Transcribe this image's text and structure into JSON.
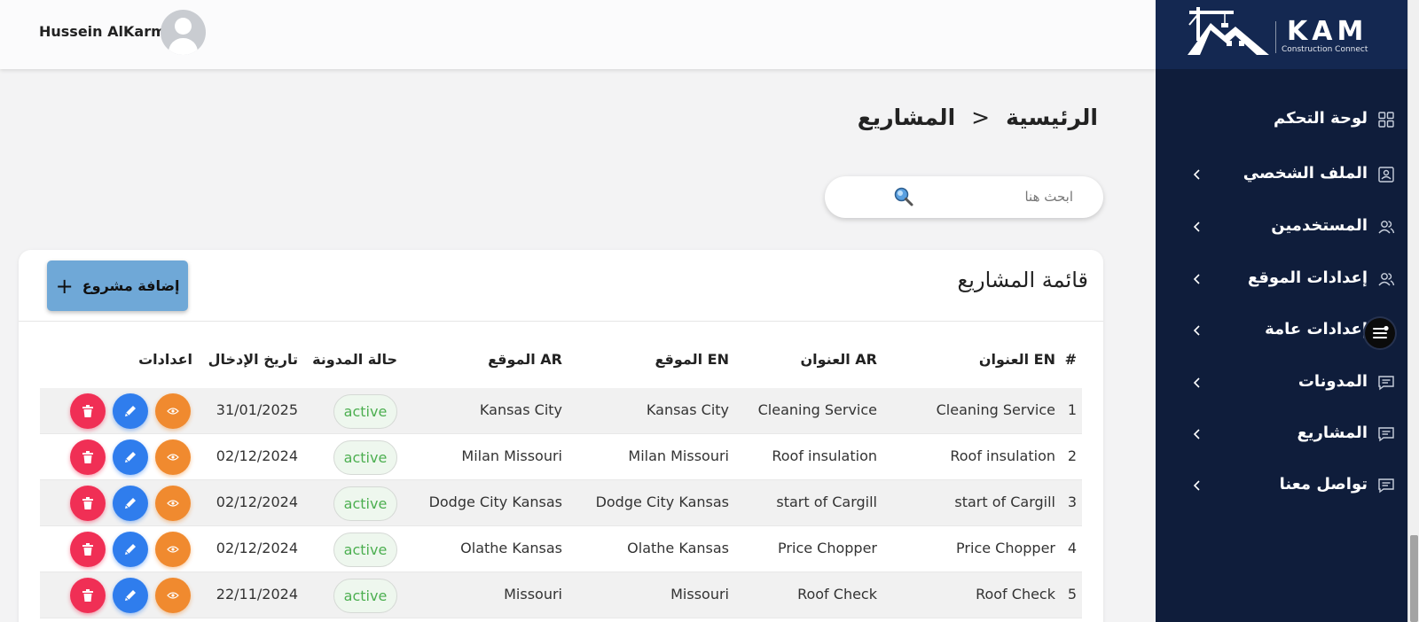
{
  "header": {
    "user_name": "Hussein AlKarmi"
  },
  "logo": {
    "name": "KAM",
    "tagline": "Construction Connect"
  },
  "sidebar": {
    "items": [
      {
        "label": "لوحة التحكم",
        "icon": "grid-icon",
        "has_chevron": false
      },
      {
        "label": "الملف الشخصي",
        "icon": "profile-card-icon",
        "has_chevron": true
      },
      {
        "label": "المستخدمين",
        "icon": "users-icon",
        "has_chevron": true
      },
      {
        "label": "إعدادات الموقع",
        "icon": "users-icon",
        "has_chevron": true
      },
      {
        "label": "إعدادات عامة",
        "icon": "settings-icon",
        "has_chevron": true
      },
      {
        "label": "المدونات",
        "icon": "message-icon",
        "has_chevron": true
      },
      {
        "label": "المشاريع",
        "icon": "message-icon",
        "has_chevron": true
      },
      {
        "label": "تواصل معنا",
        "icon": "message-icon",
        "has_chevron": true
      }
    ]
  },
  "breadcrumb": {
    "home": "الرئيسية",
    "separator": ">",
    "current": "المشاريع"
  },
  "search": {
    "placeholder": "ابحث هنا"
  },
  "card": {
    "title": "قائمة المشاريع",
    "add_button_label": "إضافة مشروع"
  },
  "table": {
    "headers": {
      "num": "#",
      "title_en": "العنوان EN",
      "title_ar": "العنوان AR",
      "loc_en": "الموقع EN",
      "loc_ar": "الموقع AR",
      "status": "حالة المدونة",
      "date": "تاريخ الإدخال",
      "actions": "اعدادات"
    },
    "rows": [
      {
        "num": "1",
        "title_en": "Cleaning Service",
        "title_ar": "Cleaning Service",
        "loc_en": "Kansas City",
        "loc_ar": "Kansas City",
        "status": "active",
        "date": "31/01/2025"
      },
      {
        "num": "2",
        "title_en": "Roof insulation",
        "title_ar": "Roof insulation",
        "loc_en": "Milan Missouri",
        "loc_ar": "Milan Missouri",
        "status": "active",
        "date": "02/12/2024"
      },
      {
        "num": "3",
        "title_en": "start of Cargill",
        "title_ar": "start of Cargill",
        "loc_en": "Dodge City Kansas",
        "loc_ar": "Dodge City Kansas",
        "status": "active",
        "date": "02/12/2024"
      },
      {
        "num": "4",
        "title_en": "Price Chopper",
        "title_ar": "Price Chopper",
        "loc_en": "Olathe Kansas",
        "loc_ar": "Olathe Kansas",
        "status": "active",
        "date": "02/12/2024"
      },
      {
        "num": "5",
        "title_en": "Roof Check",
        "title_ar": "Roof Check",
        "loc_en": "Missouri",
        "loc_ar": "Missouri",
        "status": "active",
        "date": "22/11/2024"
      }
    ]
  },
  "colors": {
    "sidebar_bg": "#0f1d3b",
    "logo_bg": "#142851",
    "add_button": "#6fa8d7",
    "view_action": "#f08a2f",
    "edit_action": "#2f7ded",
    "delete_action": "#f02f55",
    "status_active_text": "#4caf50"
  }
}
